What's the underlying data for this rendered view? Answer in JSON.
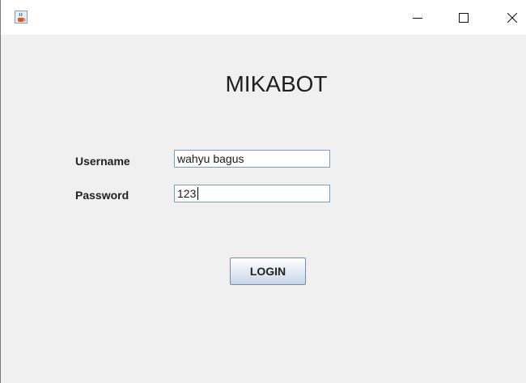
{
  "window": {
    "controls": {
      "minimize_icon": "minimize-icon",
      "maximize_icon": "maximize-icon",
      "close_icon": "close-icon"
    },
    "app_icon": "java-cup-icon"
  },
  "form": {
    "title": "MIKABOT",
    "username_label": "Username",
    "username_value": "wahyu bagus",
    "password_label": "Password",
    "password_value": "123",
    "login_label": "LOGIN"
  },
  "colors": {
    "window_bg": "#f0f0f0",
    "titlebar_bg": "#ffffff",
    "field_border": "#7a9cbf",
    "button_border": "#7a8ba3"
  }
}
